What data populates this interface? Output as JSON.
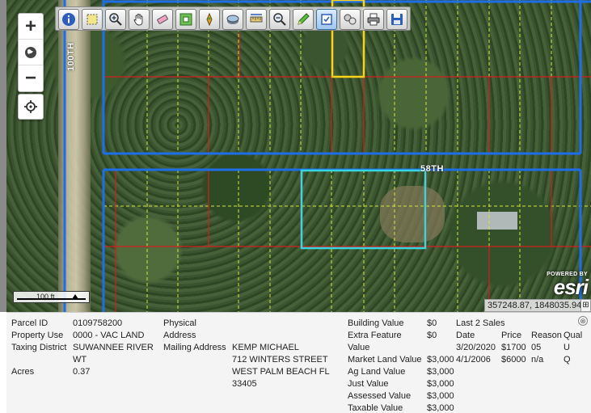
{
  "map": {
    "street_labels": {
      "vertical": "100TH",
      "horizontal": "58TH"
    },
    "scale": {
      "label": "100 ft"
    },
    "attribution": {
      "powered_by": "POWERED BY",
      "brand": "esri"
    },
    "coordinates": "357248.87, 1848035.94",
    "coordinates_toggle": "⊞",
    "controls": {
      "zoom_in": "+",
      "zoom_out": "−"
    },
    "colors": {
      "parcel_line": "#d21f1f",
      "lot_line": "#d6e63a",
      "road_line": "#1e6ee8",
      "selected_parcel": "#37d6e0",
      "highlight_parcel": "#ffd21a"
    }
  },
  "toolbar": {
    "tools": [
      "info-icon",
      "select-area-icon",
      "zoom-in-magnifier-icon",
      "pan-hand-icon",
      "eraser-icon",
      "zoom-extent-icon",
      "pin-icon",
      "layers-icon",
      "measure-icon",
      "zoom-out-magnifier-icon",
      "draw-pencil-icon",
      "identify-icon",
      "buffer-icon",
      "print-icon",
      "save-icon"
    ]
  },
  "panel": {
    "close": "⊗",
    "col1": [
      {
        "label": "Parcel ID",
        "value": "0109758200"
      },
      {
        "label": "Property Use",
        "value": "0000 - VAC LAND"
      },
      {
        "label": "Taxing District",
        "value": "SUWANNEE RIVER"
      },
      {
        "label": "",
        "value": "WT"
      },
      {
        "label": "Acres",
        "value": "0.37"
      }
    ],
    "physical_address_label": [
      "Physical",
      "Address"
    ],
    "mailing_address_label": "Mailing Address",
    "mailing_address": [
      "KEMP MICHAEL",
      "712 WINTERS STREET",
      "WEST PALM BEACH FL",
      "33405"
    ],
    "values": [
      {
        "label": "Building Value",
        "value": "$0"
      },
      {
        "label": "Extra Feature",
        "value": "$0"
      },
      {
        "label": "Value",
        "value": ""
      },
      {
        "label": "Market Land Value",
        "value": "$3,000"
      },
      {
        "label": "Ag Land Value",
        "value": "$3,000"
      },
      {
        "label": "Just Value",
        "value": "$3,000"
      },
      {
        "label": "Assessed Value",
        "value": "$3,000"
      },
      {
        "label": "Taxable Value",
        "value": "$3,000"
      }
    ],
    "sales": {
      "title": "Last 2 Sales",
      "headers": {
        "date": "Date",
        "price": "Price",
        "reason": "Reason",
        "qual": "Qual"
      },
      "rows": [
        {
          "date": "3/20/2020",
          "price": "$1700",
          "reason": "05",
          "qual": "U"
        },
        {
          "date": "4/1/2006",
          "price": "$6000",
          "reason": "n/a",
          "qual": "Q"
        }
      ]
    }
  }
}
